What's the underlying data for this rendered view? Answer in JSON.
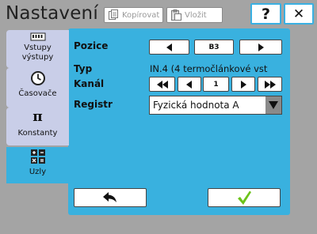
{
  "header": {
    "title": "Nastavení",
    "copy_label": "Kopírovat",
    "paste_label": "Vložit",
    "help_label": "?",
    "close_label": "✕"
  },
  "sidebar": {
    "items": [
      {
        "label": "Vstupy výstupy",
        "icon": "io-module-icon"
      },
      {
        "label": "Časovače",
        "icon": "clock-icon"
      },
      {
        "label": "Konstanty",
        "icon": "pi-icon"
      },
      {
        "label": "Uzly",
        "icon": "calculator-icon",
        "active": true
      }
    ]
  },
  "form": {
    "position_label": "Pozice",
    "position_value": "B3",
    "type_label": "Typ",
    "type_value": "IN.4 (4 termočlánkové vst",
    "channel_label": "Kanál",
    "channel_value": "1",
    "register_label": "Registr",
    "register_value": "Fyzická hodnota A"
  },
  "colors": {
    "accent": "#39b1df",
    "background": "#a4a4a4",
    "tab_inactive": "#c9cee8",
    "confirm": "#6cc31a"
  }
}
